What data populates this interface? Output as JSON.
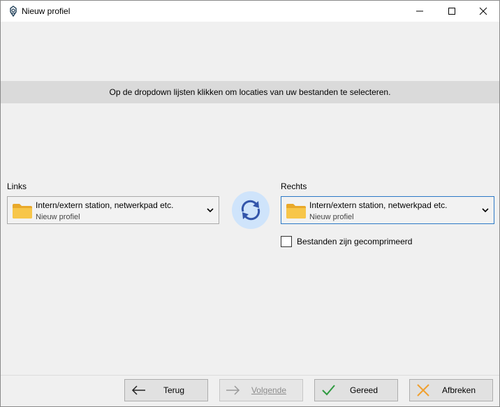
{
  "window": {
    "title": "Nieuw profiel"
  },
  "info": {
    "text": "Op de dropdown lijsten klikken om locaties van uw bestanden te selecteren."
  },
  "left": {
    "label": "Links",
    "location": "Intern/extern station, netwerkpad etc.",
    "profile": "Nieuw profiel"
  },
  "right": {
    "label": "Rechts",
    "location": "Intern/extern station, netwerkpad etc.",
    "profile": "Nieuw profiel",
    "compressed_label": "Bestanden zijn gecomprimeerd",
    "compressed_checked": false
  },
  "footer": {
    "back_label": "Terug",
    "next_label": "Volgende",
    "finish_label": "Gereed",
    "cancel_label": "Afbreken"
  },
  "colors": {
    "accent_blue": "#2b78c6",
    "swap_bg": "#cfe4fb",
    "folder": "#f7c64a",
    "check_green": "#2e9a3f",
    "cancel_orange": "#f0a030"
  },
  "icons": {
    "app": "app-logo-icon",
    "swap": "sync-arrows-icon",
    "folder": "folder-icon"
  }
}
